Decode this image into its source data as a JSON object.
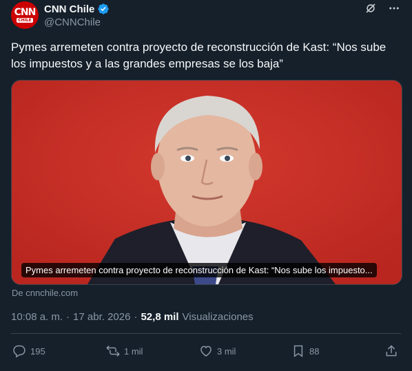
{
  "tweet": {
    "author": {
      "avatar_text": "CNN",
      "avatar_subtext": "CHILE",
      "display_name": "CNN Chile",
      "handle": "@CNNChile"
    },
    "text": "Pymes arremeten contra proyecto de reconstrucción de Kast: “Nos sube los impuestos y a las grandes empresas se los baja”",
    "media": {
      "caption": "Pymes arremeten contra proyecto de reconstrucción de Kast: “Nos sube los impuesto...",
      "icon": "portrait-photo"
    },
    "source": "De cnnchile.com",
    "time": "10:08 a. m.",
    "separator": "·",
    "date": "17 abr. 2026",
    "views_count": "52,8 mil",
    "views_label": "Visualizaciones",
    "actions": {
      "replies": "195",
      "reposts": "1 mil",
      "likes": "3 mil",
      "bookmarks": "88"
    }
  },
  "colors": {
    "background": "#15202b",
    "verified": "#1d9bf0",
    "muted": "#8b98a5",
    "brand_red": "#cc0000"
  }
}
